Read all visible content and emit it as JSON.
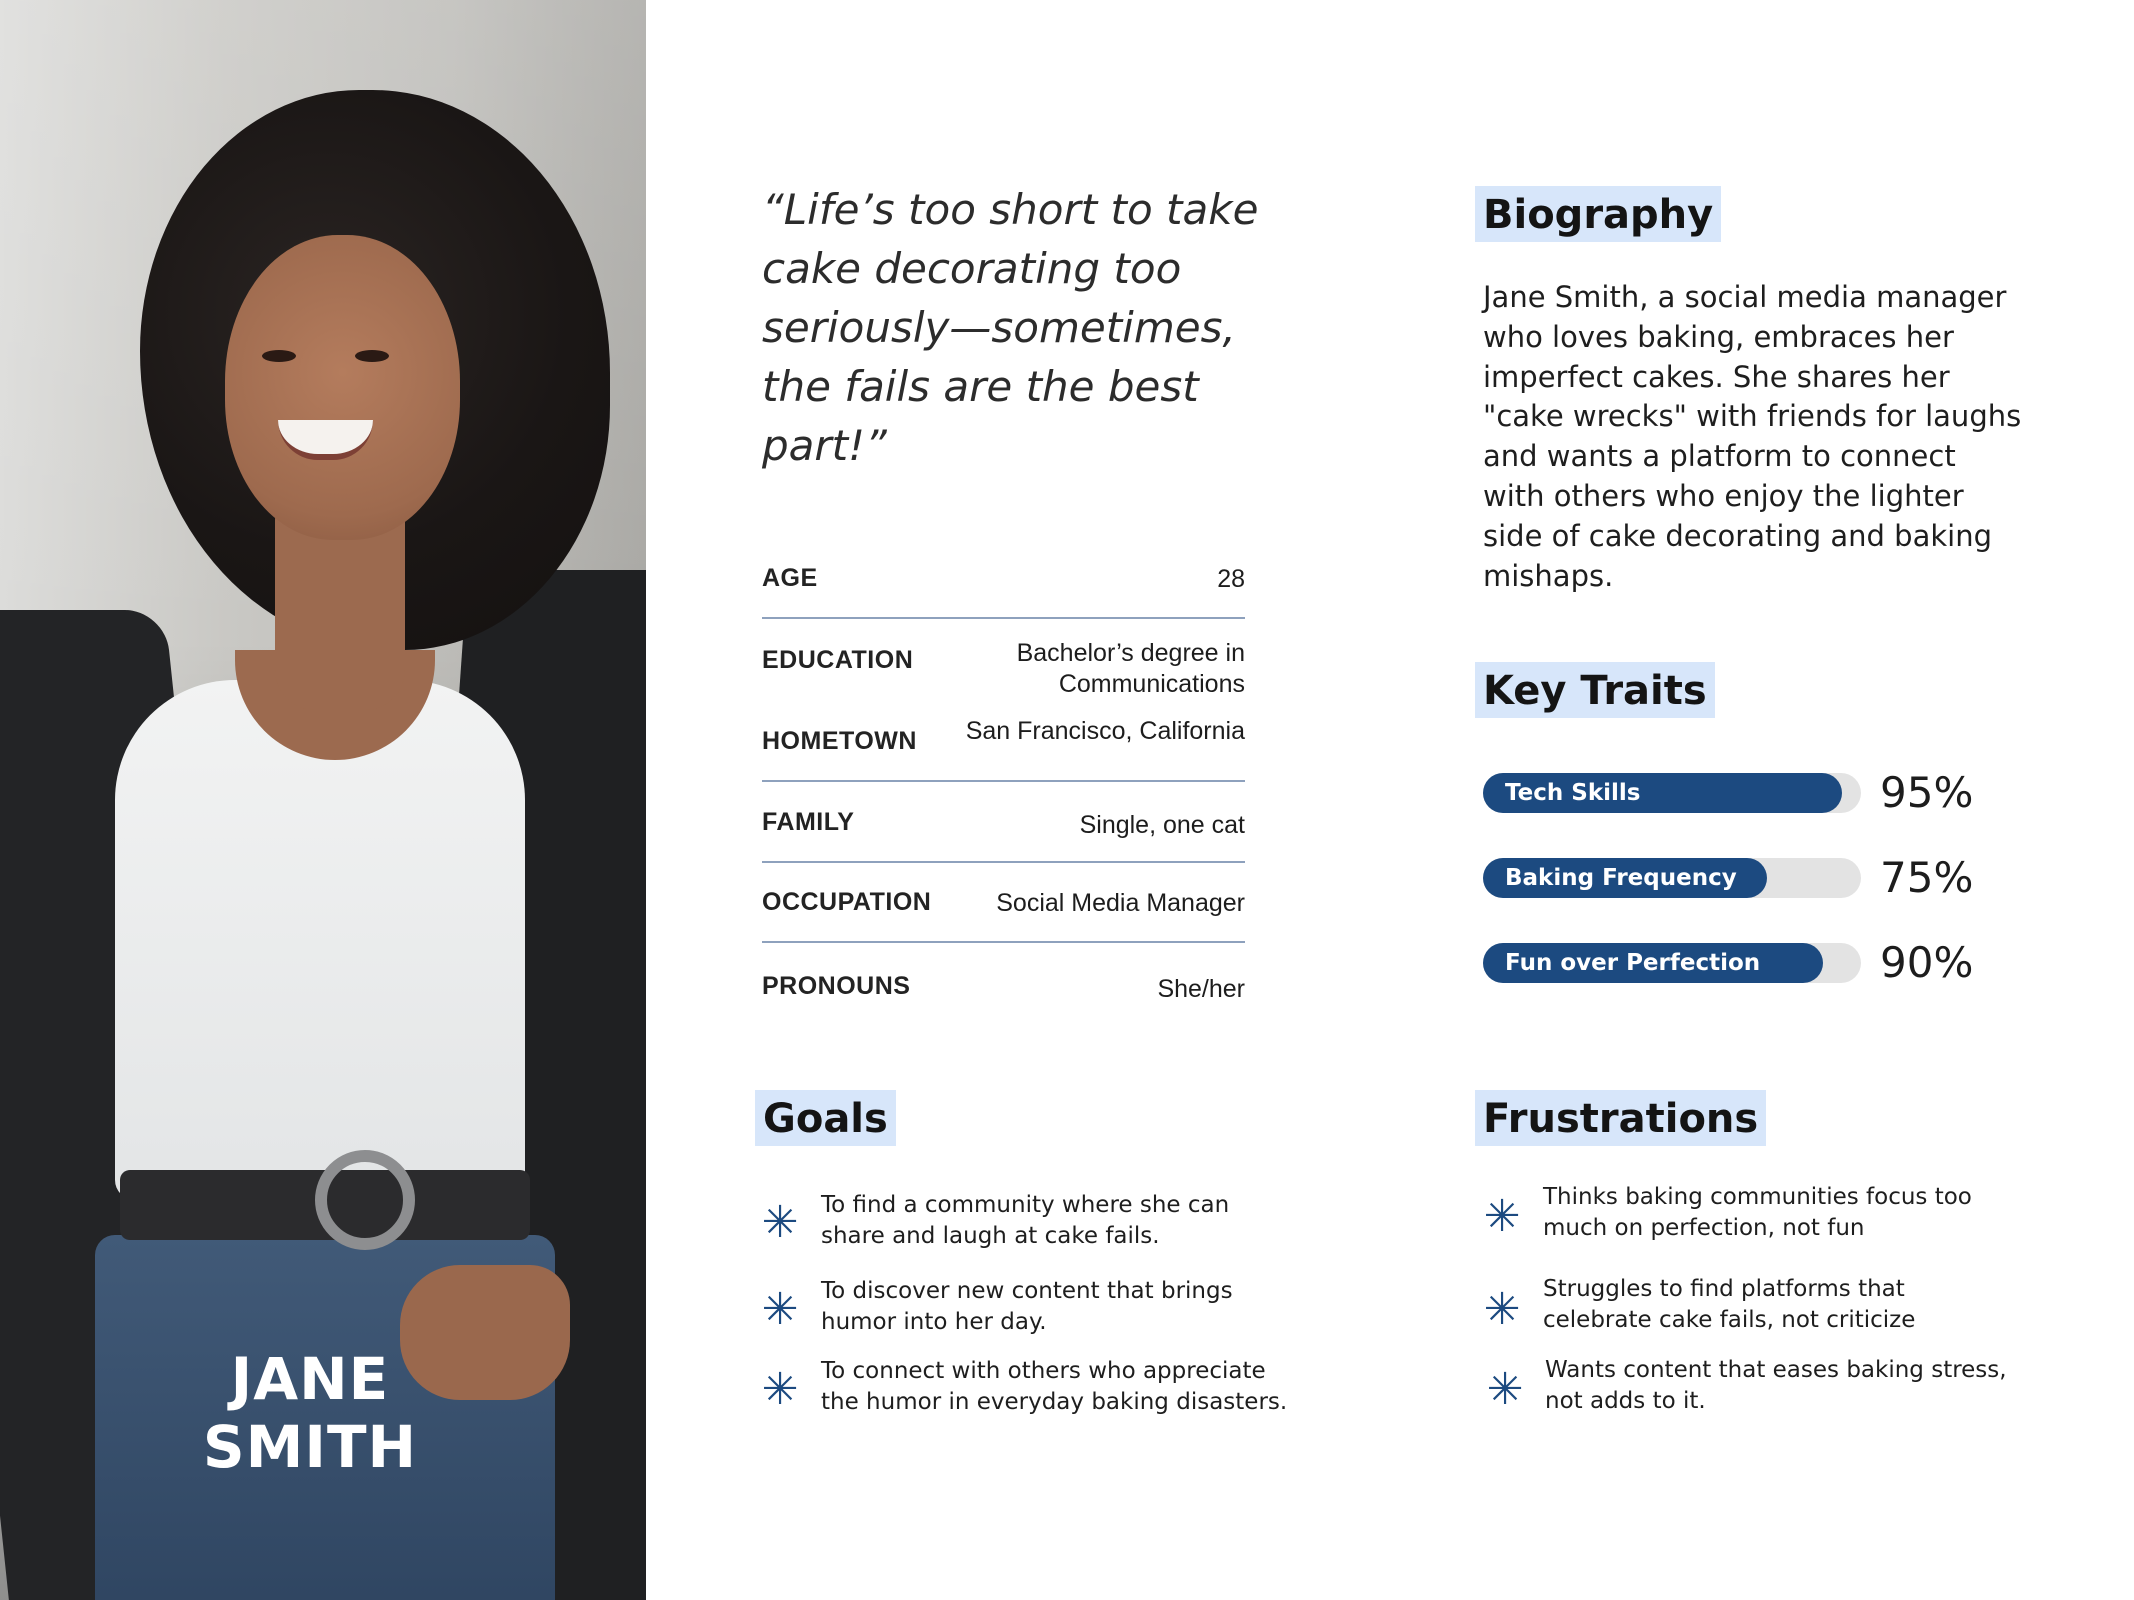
{
  "persona": {
    "name_line1": "JANE",
    "name_line2": "SMITH",
    "quote": "“Life’s too short to take cake decorating too seriously—sometimes, the fails are the best part!”"
  },
  "info": [
    {
      "label": "AGE",
      "value": "28"
    },
    {
      "label": "EDUCATION",
      "value": "Bachelor’s degree in Communications"
    },
    {
      "label": "HOMETOWN",
      "value": "San Francisco, California"
    },
    {
      "label": "FAMILY",
      "value": "Single, one cat"
    },
    {
      "label": "OCCUPATION",
      "value": "Social Media Manager"
    },
    {
      "label": "PRONOUNS",
      "value": "She/her"
    }
  ],
  "biography": {
    "heading": "Biography",
    "text": "Jane Smith, a social media manager who loves baking, embraces her imperfect cakes. She shares her \"cake wrecks\" with friends for laughs and wants a platform to connect with others who enjoy the lighter side of cake decorating and baking mishaps."
  },
  "key_traits": {
    "heading": "Key Traits",
    "traits": [
      {
        "label": "Tech Skills",
        "percent_text": "95%",
        "level": 0.95
      },
      {
        "label": "Baking Frequency",
        "percent_text": "75%",
        "level": 0.75
      },
      {
        "label": "Fun over Perfection",
        "percent_text": "90%",
        "level": 0.9
      }
    ]
  },
  "goals": {
    "heading": "Goals",
    "items": [
      "To find a community where she can share and laugh at cake fails.",
      "To discover new content that brings humor into her day.",
      "To connect with others who appreciate the humor in everyday baking disasters."
    ]
  },
  "frustrations": {
    "heading": "Frustrations",
    "items": [
      "Thinks baking communities focus too much on perfection, not fun",
      "Struggles to find platforms that celebrate cake fails, not criticize",
      "Wants content that eases baking stress, not adds to it."
    ]
  },
  "colors": {
    "accent": "#1c4a80",
    "heading_highlight": "#d7e6fa",
    "track": "#e3e3e3"
  },
  "icons": {
    "bullet": "asterisk-icon"
  }
}
